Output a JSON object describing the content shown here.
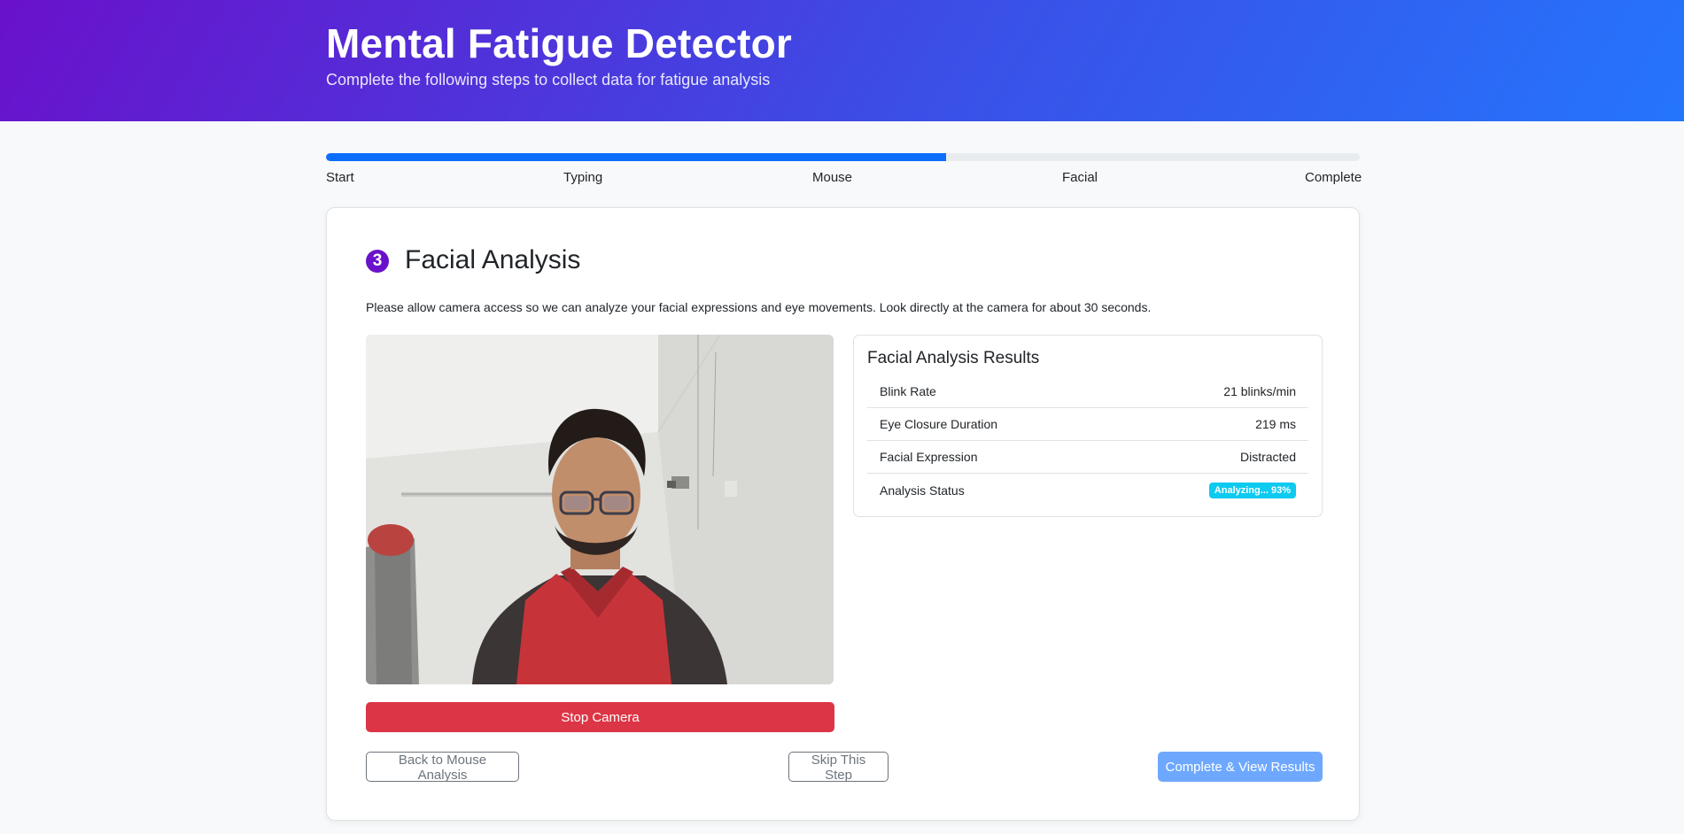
{
  "header": {
    "title": "Mental Fatigue Detector",
    "subtitle": "Complete the following steps to collect data for fatigue analysis"
  },
  "progress": {
    "fraction": 0.6,
    "steps": [
      "Start",
      "Typing",
      "Mouse",
      "Facial",
      "Complete"
    ]
  },
  "step": {
    "number": "3",
    "title": "Facial Analysis",
    "instructions": "Please allow camera access so we can analyze your facial expressions and eye movements. Look directly at the camera for about 30 seconds."
  },
  "camera": {
    "stop_label": "Stop Camera"
  },
  "results": {
    "title": "Facial Analysis Results",
    "rows": [
      {
        "label": "Blink Rate",
        "value": "21 blinks/min"
      },
      {
        "label": "Eye Closure Duration",
        "value": "219 ms"
      },
      {
        "label": "Facial Expression",
        "value": "Distracted"
      },
      {
        "label": "Analysis Status",
        "value": "Analyzing... 93%"
      }
    ]
  },
  "actions": {
    "back_label": "Back to Mouse Analysis",
    "skip_label": "Skip This Step",
    "complete_label": "Complete & View Results"
  },
  "colors": {
    "header_gradient_start": "#6a11cb",
    "header_gradient_end": "#2575fc",
    "progress_fill": "#0d6efd",
    "stop_button": "#dc3545",
    "status_badge": "#0dcaf0",
    "primary_button": "#6ea8fe"
  }
}
